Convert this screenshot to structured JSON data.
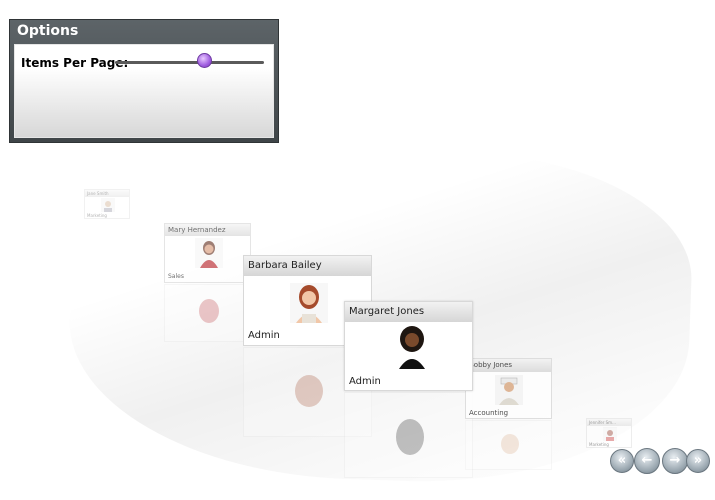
{
  "options": {
    "title": "Options",
    "items_per_page_label": "Items Per Page:",
    "items_per_page_slider_fraction": 0.6
  },
  "cards": [
    {
      "name": "Jane Smith",
      "department": "Marketing",
      "emphasis": "far"
    },
    {
      "name": "Mary Hernandez",
      "department": "Sales",
      "emphasis": "mid"
    },
    {
      "name": "Barbara Bailey",
      "department": "Admin",
      "emphasis": "near"
    },
    {
      "name": "Margaret Jones",
      "department": "Admin",
      "emphasis": "selected"
    },
    {
      "name": "Bobby Jones",
      "department": "Accounting",
      "emphasis": "mid"
    },
    {
      "name": "Jennifer Sm...",
      "department": "Marketing",
      "emphasis": "far"
    }
  ],
  "navigation": {
    "first_glyph": "«",
    "previous_glyph": "←",
    "next_glyph": "→",
    "last_glyph": "»"
  },
  "colors": {
    "panel_header": "#4f5659",
    "slider_thumb": "#a05ee0",
    "nav_button": "#9aa7b0"
  }
}
